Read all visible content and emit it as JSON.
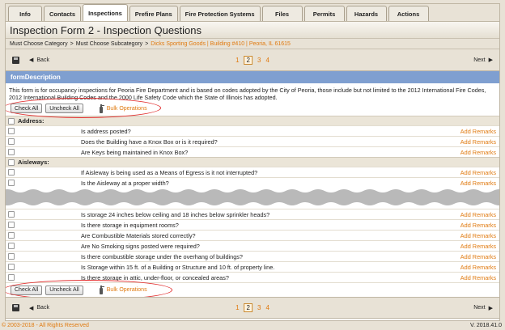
{
  "tabs": [
    {
      "label": "Info"
    },
    {
      "label": "Contacts"
    },
    {
      "label": "Inspections",
      "active": true
    },
    {
      "label": "Prefire Plans"
    },
    {
      "label": "Fire Protection Systems"
    },
    {
      "label": "Files"
    },
    {
      "label": "Permits"
    },
    {
      "label": "Hazards"
    },
    {
      "label": "Actions"
    }
  ],
  "title": "Inspection Form 2 - Inspection Questions",
  "breadcrumb": {
    "category": "Must Choose Category",
    "sep1": ">",
    "subcategory": "Must Choose Subcategory",
    "sep2": ">",
    "location": "Dicks Sporting Goods | Building #410 | Peoria, IL 61615"
  },
  "pager": {
    "back_label": "Back",
    "next_label": "Next",
    "pages": [
      "1",
      "2",
      "3",
      "4"
    ],
    "current": "2"
  },
  "form_header": "formDescription",
  "description": "This form is for occupancy inspections for Peoria Fire Department and is based on codes adopted by the City of Peoria, those include but not limited to the 2012 International Fire Codes, 2012 International Building Codes and the 2000 Life Safety Code which the State of Illinois has adopted.",
  "bulk": {
    "check_all": "Check All",
    "uncheck_all": "Uncheck All",
    "bulk_operations": "Bulk Operations"
  },
  "sections_top": [
    {
      "name": "Address:",
      "questions": [
        "Is address posted?",
        "Does the Building have a Knox Box or is it required?",
        "Are Keys being maintained in Knox Box?"
      ]
    },
    {
      "name": "Aisleways:",
      "questions": [
        "If Aisleway is being used as a Means of Egress is it not interrupted?",
        "Is the Aisleway at a proper width?"
      ]
    }
  ],
  "questions_bottom": [
    "Is storage 24 inches below ceiling and 18 inches below sprinkler heads?",
    "Is there storage in equipment rooms?",
    "Are Combustible Materials stored correctly?",
    "Are No Smoking signs posted were required?",
    "Is there combustible storage under the overhang of buildings?",
    "Is Storage within 15 ft. of a Building or Structure and 10 ft. of property line.",
    "Is there storage in attic, under-floor, or concealed areas?"
  ],
  "remark_label": "Add Remarks",
  "footer": {
    "copyright": "© 2003-2018 - All Rights Reserved",
    "version": "V. 2018.41.0"
  },
  "colors": {
    "accent": "#e07a10",
    "header_blue": "#7f9fd0",
    "highlight": "#e23030"
  }
}
